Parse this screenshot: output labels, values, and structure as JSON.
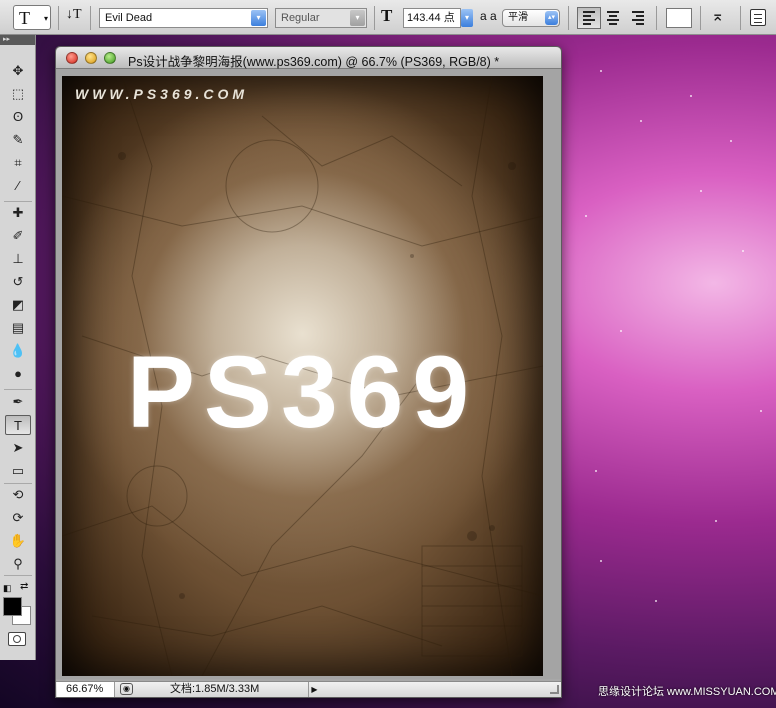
{
  "options_bar": {
    "tool_glyph": "T",
    "tool_preset_arrow": "▾",
    "orientation_glyph": "↓T",
    "font_family": "Evil Dead",
    "font_style": "Regular",
    "size_glyph": "T",
    "font_size": "143.44 点",
    "antialias_glyph": "a a",
    "antialias": "平滑",
    "dropdown_arrow": "▾",
    "stepper_arrow": "▴▾",
    "warp_glyph": "⌅",
    "text_color": "#ffffff"
  },
  "tools_panel": {
    "grip_label": "▸▸",
    "tools": [
      {
        "name": "move-tool",
        "glyph": "✥"
      },
      {
        "name": "marquee-tool",
        "glyph": "⬚"
      },
      {
        "name": "lasso-tool",
        "glyph": "ʘ"
      },
      {
        "name": "quick-selection-tool",
        "glyph": "✎"
      },
      {
        "name": "crop-tool",
        "glyph": "⌗"
      },
      {
        "name": "eyedropper-tool",
        "glyph": "⁄"
      },
      {
        "name": "healing-brush-tool",
        "glyph": "✚"
      },
      {
        "name": "brush-tool",
        "glyph": "✐"
      },
      {
        "name": "clone-stamp-tool",
        "glyph": "⊥"
      },
      {
        "name": "history-brush-tool",
        "glyph": "↺"
      },
      {
        "name": "eraser-tool",
        "glyph": "◩"
      },
      {
        "name": "gradient-tool",
        "glyph": "▤"
      },
      {
        "name": "blur-tool",
        "glyph": "💧"
      },
      {
        "name": "dodge-tool",
        "glyph": "●"
      },
      {
        "name": "pen-tool",
        "glyph": "✒"
      },
      {
        "name": "type-tool",
        "glyph": "T"
      },
      {
        "name": "path-selection-tool",
        "glyph": "➤"
      },
      {
        "name": "shape-tool",
        "glyph": "▭"
      },
      {
        "name": "3d-rotate-tool",
        "glyph": "⟲"
      },
      {
        "name": "3d-orbit-tool",
        "glyph": "⟳"
      },
      {
        "name": "hand-tool",
        "glyph": "✋"
      },
      {
        "name": "zoom-tool",
        "glyph": "⚲"
      }
    ],
    "default_colors_glyph": "◧",
    "swap_colors_glyph": "⇄",
    "foreground_color": "#000000",
    "background_color": "#ffffff"
  },
  "document": {
    "title": "Ps设计战争黎明海报(www.ps369.com) @ 66.7% (PS369, RGB/8) *",
    "canvas": {
      "watermark_url": "WWW.PS369.COM",
      "poster_title": "PS369"
    },
    "status": {
      "zoom": "66.67%",
      "icon_glyph": "◉",
      "doc_info": "文档:1.85M/3.33M",
      "menu_glyph": "▶"
    }
  },
  "corner_watermark": "思缘设计论坛 www.MISSYUAN.COM"
}
